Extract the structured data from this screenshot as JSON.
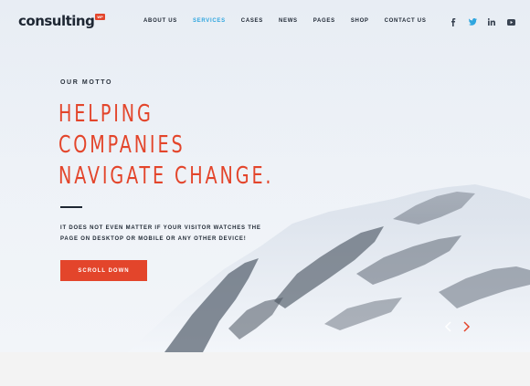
{
  "brand": {
    "name": "consulting",
    "badge": "WP",
    "accent": "#e3452b"
  },
  "nav": {
    "items": [
      {
        "label": "ABOUT US"
      },
      {
        "label": "SERVICES",
        "active": true
      },
      {
        "label": "CASES"
      },
      {
        "label": "NEWS"
      },
      {
        "label": "PAGES"
      },
      {
        "label": "SHOP"
      },
      {
        "label": "CONTACT US"
      }
    ],
    "active_color": "#2fa6df"
  },
  "social": [
    "facebook-icon",
    "twitter-icon",
    "linkedin-icon",
    "youtube-icon"
  ],
  "hero": {
    "motto": "OUR MOTTO",
    "headline": [
      "HELPING",
      "COMPANIES",
      "NAVIGATE CHANGE."
    ],
    "description": [
      "IT DOES NOT EVEN MATTER IF YOUR VISITOR WATCHES THE",
      "PAGE ON DESKTOP OR MOBILE OR ANY OTHER DEVICE!"
    ],
    "cta_label": "SCROLL DOWN"
  },
  "slider": {
    "prev_icon": "chevron-left-icon",
    "next_icon": "chevron-right-icon"
  }
}
